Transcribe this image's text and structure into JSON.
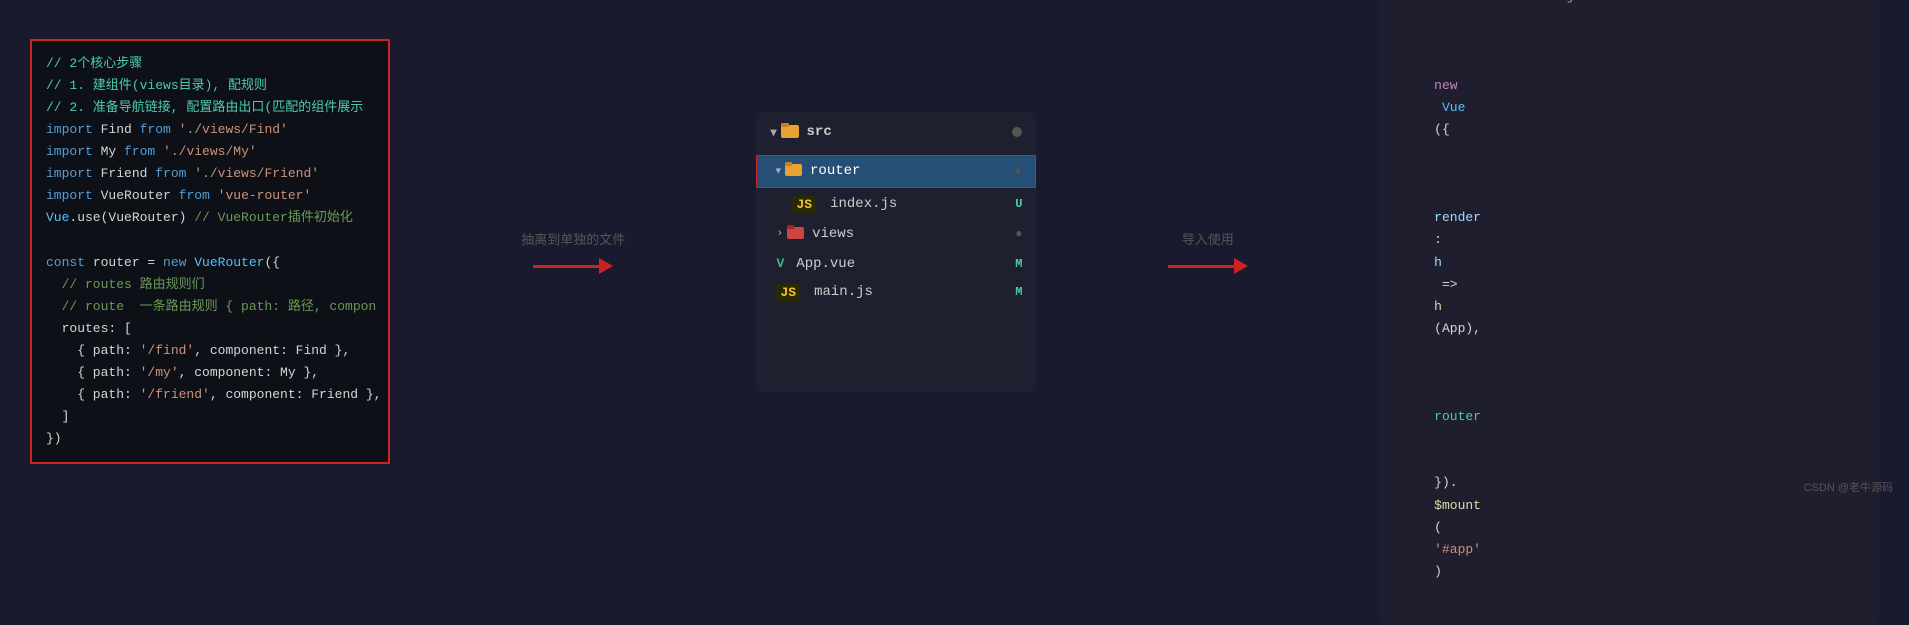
{
  "left_panel": {
    "lines": [
      {
        "type": "comment",
        "text": "// 2个核心步骤"
      },
      {
        "type": "comment",
        "text": "// 1. 建组件(views目录), 配规则"
      },
      {
        "type": "comment",
        "text": "// 2. 准备导航链接, 配置路由出口(匹配的组件展示"
      },
      {
        "type": "code",
        "parts": [
          {
            "c": "keyword",
            "t": "import"
          },
          {
            "c": "normal",
            "t": " Find "
          },
          {
            "c": "keyword",
            "t": "from"
          },
          {
            "c": "string",
            "t": " './views/Find'"
          }
        ]
      },
      {
        "type": "code",
        "parts": [
          {
            "c": "keyword",
            "t": "import"
          },
          {
            "c": "normal",
            "t": " My "
          },
          {
            "c": "keyword",
            "t": "from"
          },
          {
            "c": "string",
            "t": " './views/My'"
          }
        ]
      },
      {
        "type": "code",
        "parts": [
          {
            "c": "keyword",
            "t": "import"
          },
          {
            "c": "normal",
            "t": " Friend "
          },
          {
            "c": "keyword",
            "t": "from"
          },
          {
            "c": "string",
            "t": " './views/Friend'"
          }
        ]
      },
      {
        "type": "code",
        "parts": [
          {
            "c": "keyword",
            "t": "import"
          },
          {
            "c": "normal",
            "t": " VueRouter "
          },
          {
            "c": "keyword",
            "t": "from"
          },
          {
            "c": "string",
            "t": " 'vue-router'"
          }
        ]
      },
      {
        "type": "code",
        "parts": [
          {
            "c": "cyan",
            "t": "Vue"
          },
          {
            "c": "normal",
            "t": ".use(VueRouter) "
          },
          {
            "c": "green",
            "t": "// VueRouter插件初始化"
          }
        ]
      },
      {
        "type": "blank"
      },
      {
        "type": "code",
        "parts": [
          {
            "c": "keyword",
            "t": "const"
          },
          {
            "c": "normal",
            "t": " router = "
          },
          {
            "c": "keyword",
            "t": "new"
          },
          {
            "c": "cyan",
            "t": " VueRouter"
          },
          {
            "c": "normal",
            "t": "({"
          }
        ]
      },
      {
        "type": "code",
        "parts": [
          {
            "c": "green",
            "t": "  // routes 路由规则们"
          }
        ]
      },
      {
        "type": "code",
        "parts": [
          {
            "c": "green",
            "t": "  // route  一条路由规则 { path: 路径, compon"
          }
        ]
      },
      {
        "type": "code",
        "parts": [
          {
            "c": "normal",
            "t": "  routes: ["
          }
        ]
      },
      {
        "type": "code",
        "parts": [
          {
            "c": "normal",
            "t": "    { path: "
          },
          {
            "c": "string",
            "t": "'/find'"
          },
          {
            "c": "normal",
            "t": ", component: Find },"
          }
        ]
      },
      {
        "type": "code",
        "parts": [
          {
            "c": "normal",
            "t": "    { path: "
          },
          {
            "c": "string",
            "t": "'/my'"
          },
          {
            "c": "normal",
            "t": ", component: My },"
          }
        ]
      },
      {
        "type": "code",
        "parts": [
          {
            "c": "normal",
            "t": "    { path: "
          },
          {
            "c": "string",
            "t": "'/friend'"
          },
          {
            "c": "normal",
            "t": ", component: Friend },"
          }
        ]
      },
      {
        "type": "code",
        "parts": [
          {
            "c": "normal",
            "t": "  ]"
          }
        ]
      },
      {
        "type": "code",
        "parts": [
          {
            "c": "normal",
            "t": "})"
          }
        ]
      }
    ]
  },
  "arrow1": {
    "label": "抽离到单独的文件"
  },
  "file_tree": {
    "header": {
      "icon": "folder",
      "name": "src",
      "dot": true
    },
    "items": [
      {
        "type": "folder",
        "indent": 0,
        "chevron": "▾",
        "name": "router",
        "badge": "●",
        "selected": true,
        "bordered": true
      },
      {
        "type": "file",
        "indent": 1,
        "icon": "JS",
        "name": "index.js",
        "badge": "U",
        "selected": false
      },
      {
        "type": "folder",
        "indent": 0,
        "chevron": "›",
        "name": "views",
        "badge": "●",
        "selected": false
      },
      {
        "type": "file",
        "indent": 0,
        "icon": "V",
        "name": "App.vue",
        "badge": "M",
        "selected": false
      },
      {
        "type": "file",
        "indent": 0,
        "icon": "JS",
        "name": "main.js",
        "badge": "M",
        "selected": false
      }
    ]
  },
  "arrow2": {
    "label": "导入使用"
  },
  "right_panel": {
    "lines": [
      "import router from './router/index.js'",
      "",
      "new Vue({",
      "  render: h => h(App),",
      "  router",
      "}).$mount('#app')"
    ]
  },
  "watermark": "CSDN @老牛源码"
}
